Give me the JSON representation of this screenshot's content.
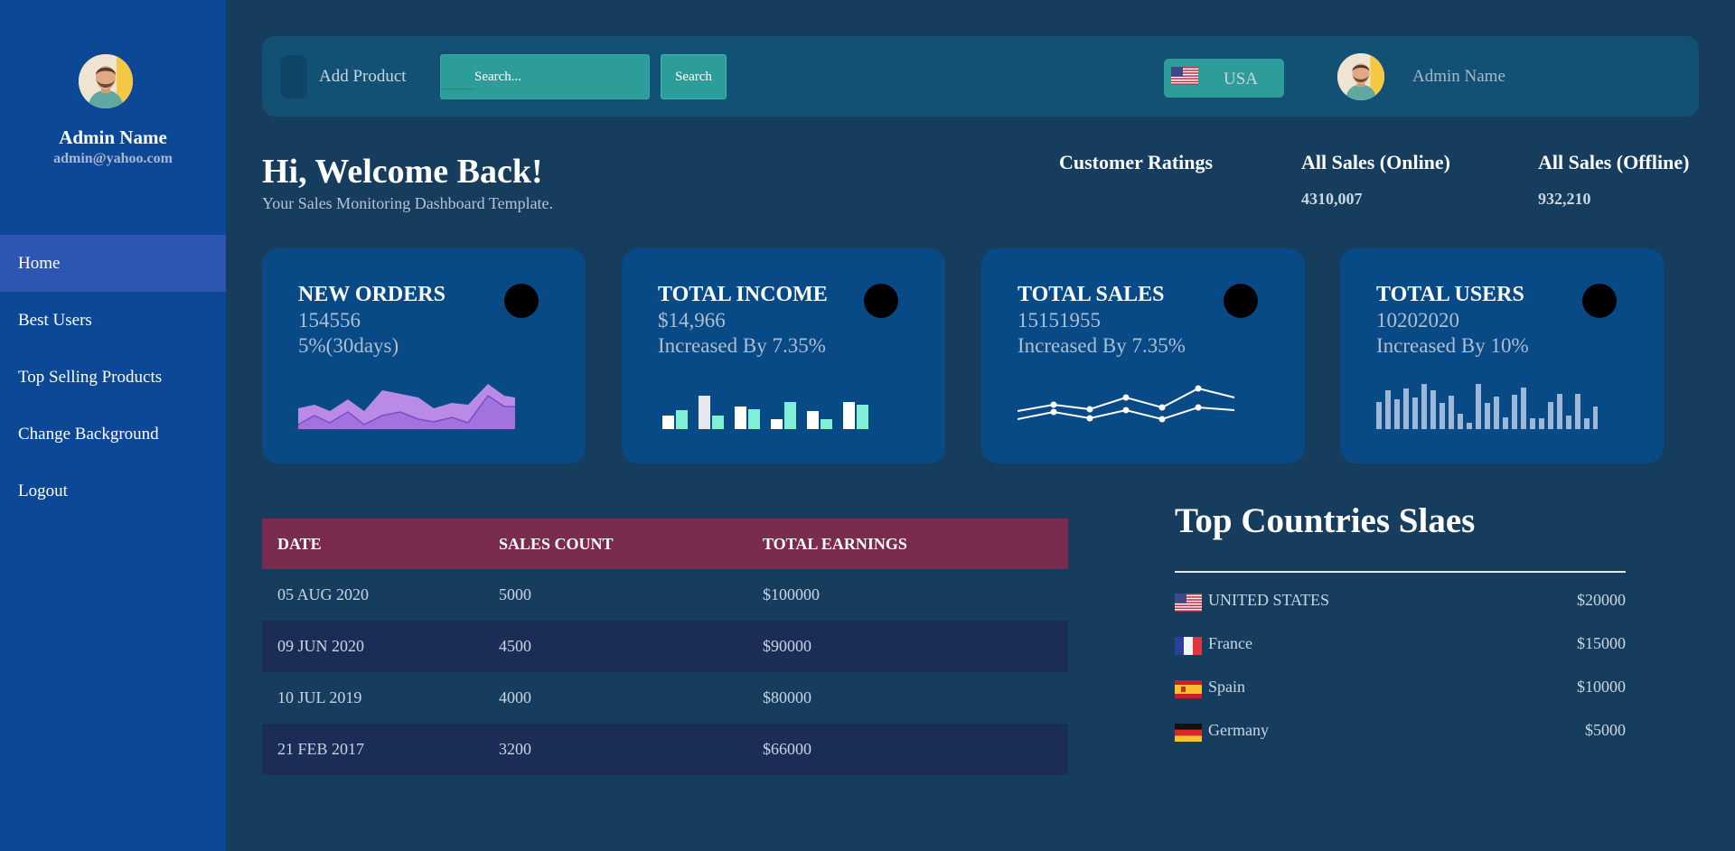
{
  "sidebar": {
    "name": "Admin Name",
    "email": "admin@yahoo.com",
    "items": [
      {
        "label": "Home"
      },
      {
        "label": "Best Users"
      },
      {
        "label": "Top Selling Products"
      },
      {
        "label": "Change Background"
      },
      {
        "label": "Logout"
      }
    ],
    "active_item": "Home"
  },
  "topbar": {
    "add_product_label": "Add Product",
    "search_placeholder": "Search...",
    "search_button": "Search",
    "country_label": "USA",
    "admin_name": "Admin Name"
  },
  "welcome": {
    "title": "Hi, Welcome Back!",
    "subtitle": "Your Sales Monitoring Dashboard Template."
  },
  "stats": [
    {
      "label": "Customer Ratings",
      "value": ""
    },
    {
      "label": "All Sales (Online)",
      "value": "4310,007"
    },
    {
      "label": "All Sales (Offline)",
      "value": "932,210"
    }
  ],
  "cards": [
    {
      "title": "NEW ORDERS",
      "value": "154556",
      "change": "5%(30days)",
      "chart": "area"
    },
    {
      "title": "TOTAL INCOME",
      "value": "$14,966",
      "change": "Increased By 7.35%",
      "chart": "bar-pairs"
    },
    {
      "title": "TOTAL SALES",
      "value": "15151955",
      "change": "Increased By 7.35%",
      "chart": "line"
    },
    {
      "title": "TOTAL USERS",
      "value": "10202020",
      "change": "Increased By 10%",
      "chart": "bars"
    }
  ],
  "table": {
    "headers": [
      "DATE",
      "SALES COUNT",
      "TOTAL EARNINGS"
    ],
    "rows": [
      [
        "05 AUG 2020",
        "5000",
        "$100000"
      ],
      [
        "09 JUN 2020",
        "4500",
        "$90000"
      ],
      [
        "10 JUL 2019",
        "4000",
        "$80000"
      ],
      [
        "21 FEB 2017",
        "3200",
        "$66000"
      ]
    ]
  },
  "countries": {
    "title": "Top Countries Slaes",
    "rows": [
      {
        "flag": "us-flag-icon",
        "name": "UNITED STATES",
        "amount": "$20000"
      },
      {
        "flag": "france-flag-icon",
        "name": "France",
        "amount": "$15000"
      },
      {
        "flag": "spain-flag-icon",
        "name": "Spain",
        "amount": "$10000"
      },
      {
        "flag": "germany-flag-icon",
        "name": "Germany",
        "amount": "$5000"
      }
    ]
  },
  "colors": {
    "background": "#163d5e",
    "sidebar": "#0d4896",
    "sidebar_active": "#2d56b3",
    "topbar": "#125074",
    "teal": "#2c9d99",
    "card": "#084a86",
    "table_header": "#7b2b4e",
    "table_alt_row": "#1b2c57"
  }
}
